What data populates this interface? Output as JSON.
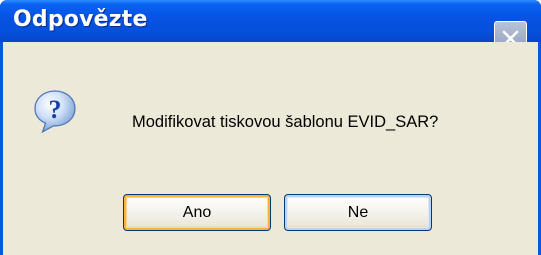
{
  "dialog": {
    "title": "Odpovězte",
    "message": "Modifikovat tiskovou šablonu EVID_SAR?",
    "icon": "question-icon",
    "close_icon": "close-icon"
  },
  "buttons": {
    "yes_label": "Ano",
    "no_label": "Ne"
  },
  "colors": {
    "titlebar": "#0653e4",
    "client": "#ece9d8",
    "default_button_highlight": "#f8b43a"
  }
}
